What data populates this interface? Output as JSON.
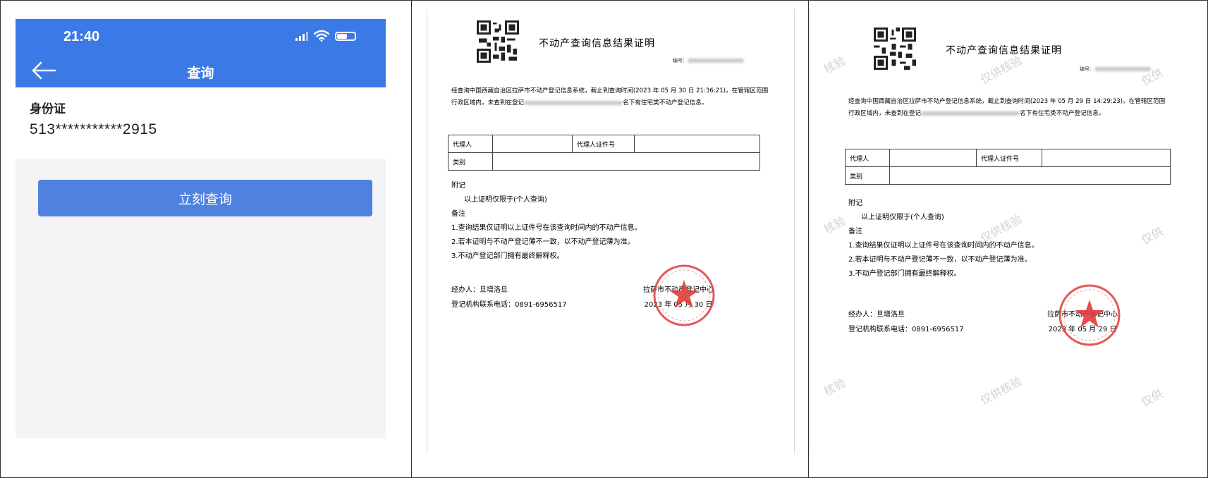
{
  "phone": {
    "status_time": "21:40",
    "page_title": "查询",
    "id_label": "身份证",
    "id_number": "513***********2915",
    "query_button": "立刻查询",
    "accent": "#3b7ae6"
  },
  "documents": [
    {
      "title": "不动产查询信息结果证明",
      "number_prefix": "编号：",
      "body": "经查询中国西藏自治区拉萨市不动产登记信息系统，截止到查询时间(2023 年 05 月 30 日 21:36:21)，在管辖区范围行政区域内，未查到在登记",
      "body_tail": "名下有住宅类不动产登记信息。",
      "table": {
        "agent": "代理人",
        "agent_id": "代理人证件号",
        "type": "类别"
      },
      "appendix_heading": "附记",
      "appendix_text": "以上证明仅限于(个人查询)",
      "notes_heading": "备注",
      "notes": [
        "1.查询结果仅证明以上证件号在该查询时间内的不动产信息。",
        "2.若本证明与不动产登记薄不一致，以不动产登记薄为准。",
        "3.不动产登记部门拥有最终解释权。"
      ],
      "handler": "经办人：旦增洛旦",
      "phone_line": "登记机构联系电话：0891-6956517",
      "org": "拉萨市不动产登记中心",
      "date": "2023 年 05 月 30 日"
    },
    {
      "title": "不动产查询信息结果证明",
      "number_prefix": "编号：",
      "body": "经查询中国西藏自治区拉萨市不动产登记信息系统，截止到查询时间(2023 年 05 月 29 日 14:29:23)，在管辖区范围行政区域内，未查到在登记",
      "body_tail": "名下有住宅类不动产登记信息。",
      "table": {
        "agent": "代理人",
        "agent_id": "代理人证件号",
        "type": "类别"
      },
      "appendix_heading": "附记",
      "appendix_text": "以上证明仅限于(个人查询)",
      "notes_heading": "备注",
      "notes": [
        "1.查询结果仅证明以上证件号在该查询时间内的不动产信息。",
        "2.若本证明与不动产登记薄不一致，以不动产登记薄为准。",
        "3.不动产登记部门拥有最终解释权。"
      ],
      "handler": "经办人：旦增洛旦",
      "phone_line": "登记机构联系电话：0891-6956517",
      "org": "拉萨市不动产登记中心",
      "date": "2023 年 05 月 29 日",
      "watermarks": [
        "核验",
        "仅供核验",
        "仅供"
      ]
    }
  ],
  "seal_color": "#e23b3b"
}
